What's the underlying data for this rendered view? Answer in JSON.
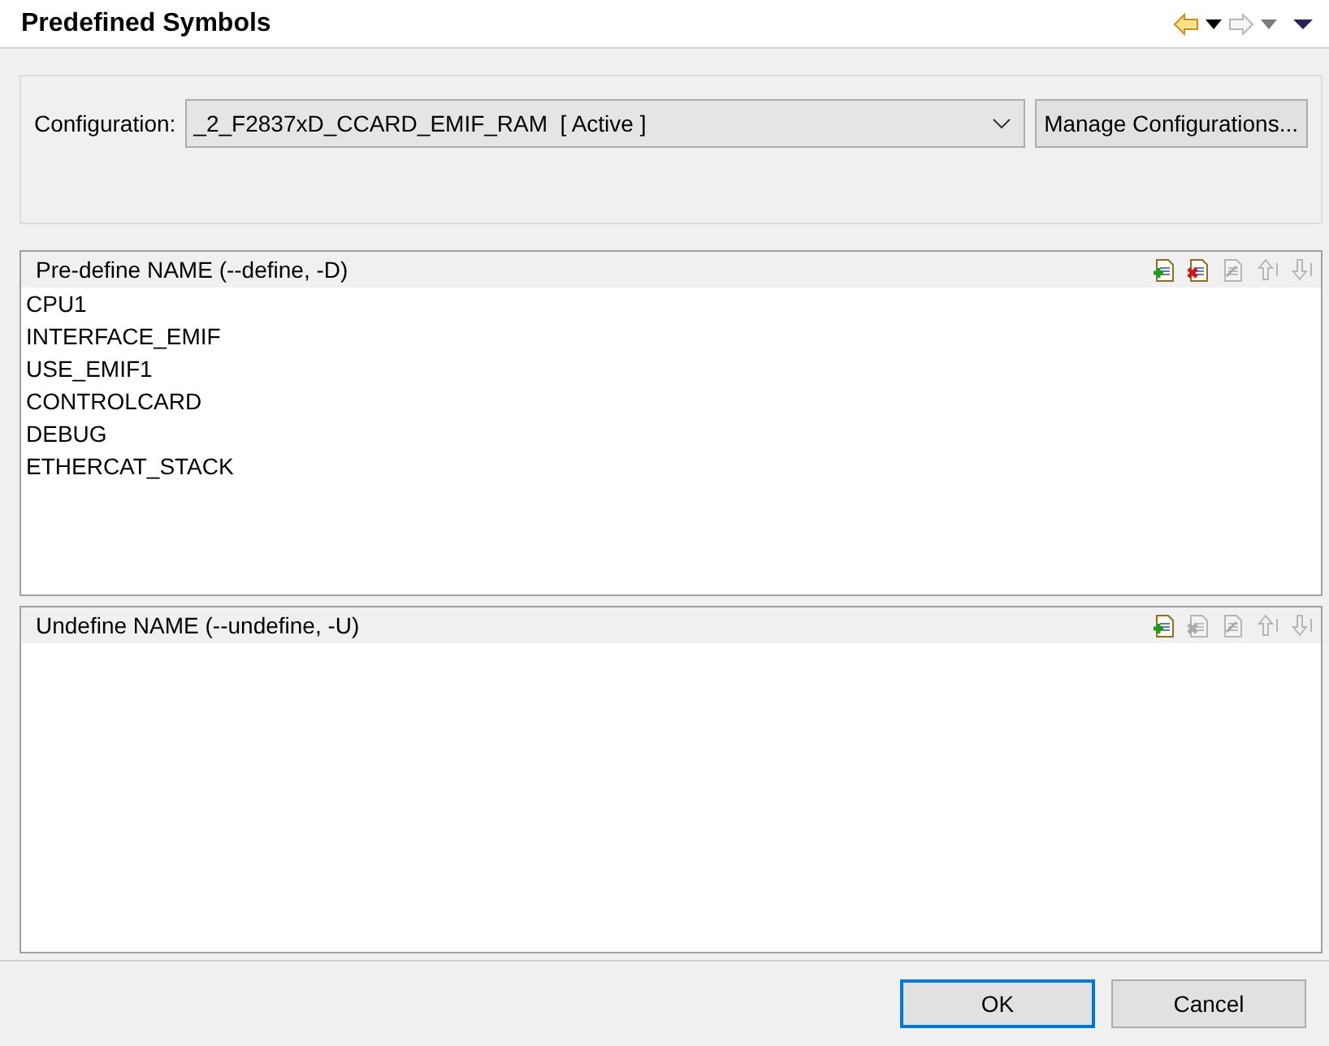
{
  "title": "Predefined Symbols",
  "nav": [
    {
      "kind": "back",
      "disabled": false
    },
    {
      "kind": "menu",
      "disabled": false
    },
    {
      "kind": "forward",
      "disabled": true
    },
    {
      "kind": "menu",
      "disabled": true
    },
    {
      "kind": "view",
      "disabled": false
    }
  ],
  "configuration": {
    "label": "Configuration:",
    "value": "_2_F2837xD_CCARD_EMIF_RAM  [ Active ]",
    "manage_button": "Manage Configurations..."
  },
  "panels": [
    {
      "title": "Pre-define NAME (--define, -D)",
      "tools": [
        {
          "kind": "add",
          "disabled": false
        },
        {
          "kind": "delete",
          "disabled": false
        },
        {
          "kind": "edit",
          "disabled": true
        },
        {
          "kind": "up",
          "disabled": true
        },
        {
          "kind": "down",
          "disabled": true
        }
      ],
      "items": [
        "CPU1",
        "INTERFACE_EMIF",
        "USE_EMIF1",
        "CONTROLCARD",
        "DEBUG",
        "ETHERCAT_STACK"
      ]
    },
    {
      "title": "Undefine NAME (--undefine, -U)",
      "tools": [
        {
          "kind": "add",
          "disabled": false
        },
        {
          "kind": "delete",
          "disabled": true
        },
        {
          "kind": "edit",
          "disabled": true
        },
        {
          "kind": "up",
          "disabled": true
        },
        {
          "kind": "down",
          "disabled": true
        }
      ]
    }
  ],
  "buttons": [
    {
      "label": "OK",
      "default": true
    },
    {
      "label": "Cancel",
      "default": false
    }
  ]
}
